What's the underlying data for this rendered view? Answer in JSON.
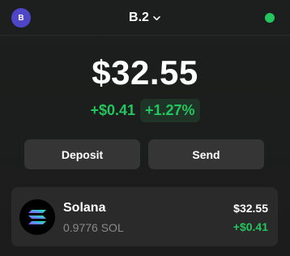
{
  "header": {
    "avatar_initial": "B",
    "account_name": "B.2",
    "chevron_icon": "chevron-down-icon",
    "status_color": "#22c55e"
  },
  "portfolio": {
    "balance": "$32.55",
    "change_abs": "+$0.41",
    "change_pct": "+1.27%"
  },
  "actions": {
    "deposit_label": "Deposit",
    "send_label": "Send"
  },
  "tokens": [
    {
      "name": "Solana",
      "amount": "0.9776 SOL",
      "value": "$32.55",
      "change": "+$0.41",
      "icon": "solana-logo-icon"
    }
  ],
  "colors": {
    "accent_green": "#22c55e",
    "avatar": "#4f46c7",
    "button_bg": "#353535",
    "card_bg": "#2a2a2a"
  }
}
